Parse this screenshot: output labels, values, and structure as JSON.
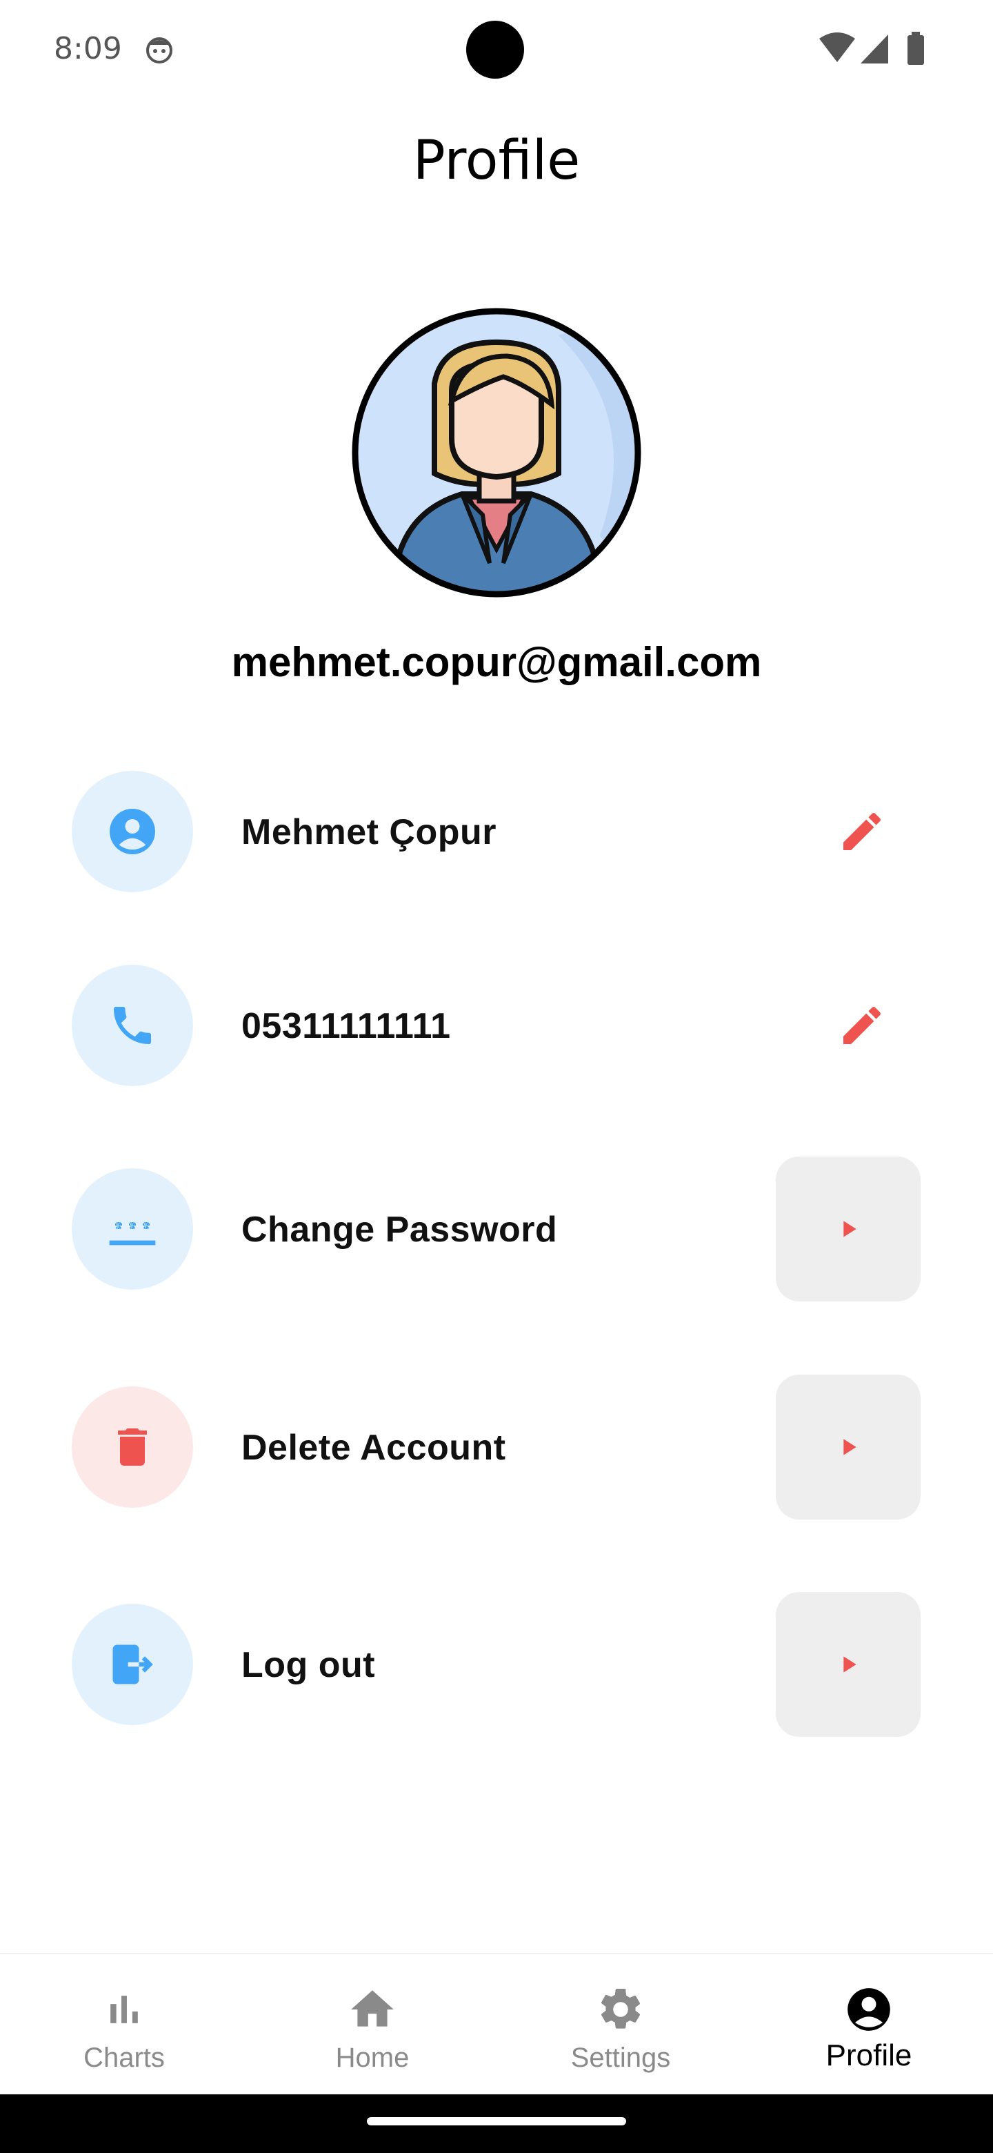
{
  "status_bar": {
    "time": "8:09"
  },
  "header": {
    "title": "Profile"
  },
  "profile": {
    "email": "mehmet.copur@gmail.com"
  },
  "rows": [
    {
      "label": "Mehmet Çopur",
      "icon": "person-icon",
      "action": "edit"
    },
    {
      "label": "05311111111",
      "icon": "phone-icon",
      "action": "edit"
    },
    {
      "label": "Change Password",
      "icon": "password-icon",
      "action": "arrow"
    },
    {
      "label": "Delete Account",
      "icon": "trash-icon",
      "action": "arrow"
    },
    {
      "label": "Log out",
      "icon": "logout-icon",
      "action": "arrow"
    }
  ],
  "bottom_nav": {
    "items": [
      {
        "label": "Charts",
        "icon": "bar-chart-icon",
        "active": false
      },
      {
        "label": "Home",
        "icon": "home-icon",
        "active": false
      },
      {
        "label": "Settings",
        "icon": "gear-icon",
        "active": false
      },
      {
        "label": "Profile",
        "icon": "account-circle-icon",
        "active": true
      }
    ]
  },
  "colors": {
    "accent_blue": "#42a5f5",
    "blue_circle_bg": "#e3f1fd",
    "accent_red": "#ef5350",
    "red_circle_bg": "#fde8e8",
    "arrow_button_bg": "#eeeeee",
    "nav_inactive": "#8a8a8a",
    "nav_active": "#000000"
  }
}
